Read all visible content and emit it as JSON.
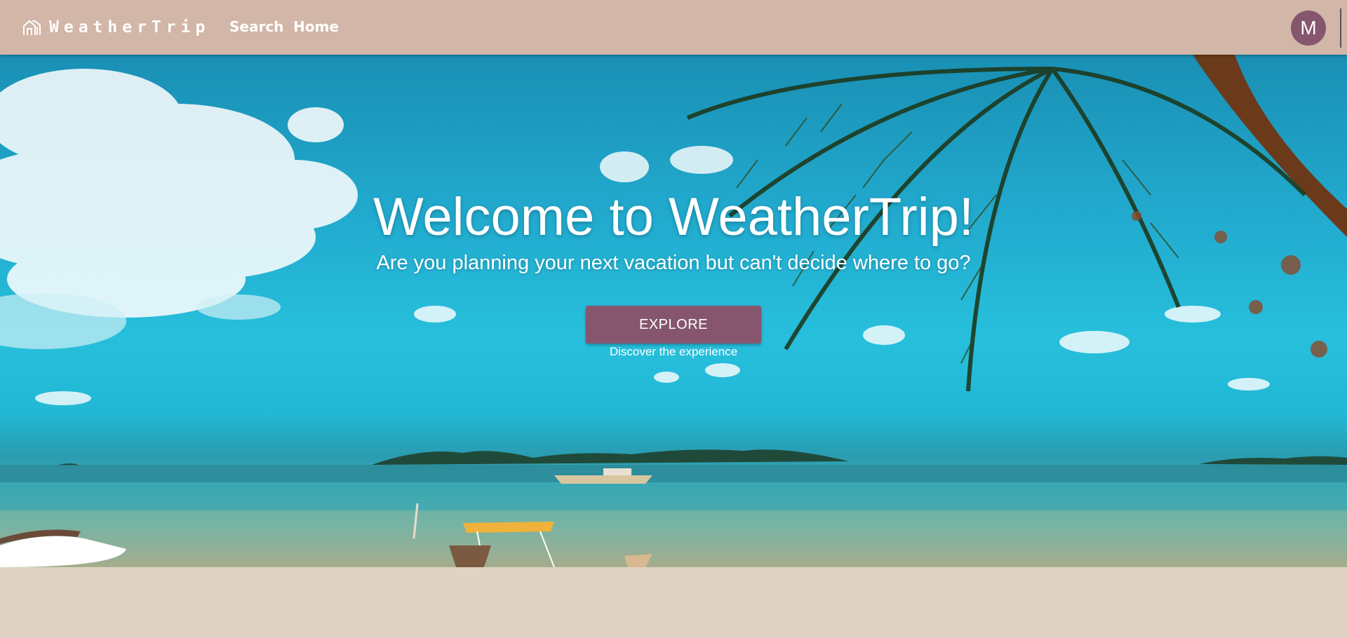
{
  "nav": {
    "brand": "WeatherTrip",
    "links": [
      {
        "label": "Search"
      },
      {
        "label": "Home"
      }
    ],
    "avatar_initial": "M"
  },
  "hero": {
    "title": "Welcome to WeatherTrip!",
    "subtitle": "Are you planning your next vacation but can't decide where to go?",
    "cta_label": "EXPLORE",
    "cta_caption": "Discover the experience"
  },
  "colors": {
    "navbar": "#d2b6a7",
    "accent": "#85566e",
    "page_background": "#e0d3c4"
  },
  "icons": {
    "brand": "house-icon"
  }
}
